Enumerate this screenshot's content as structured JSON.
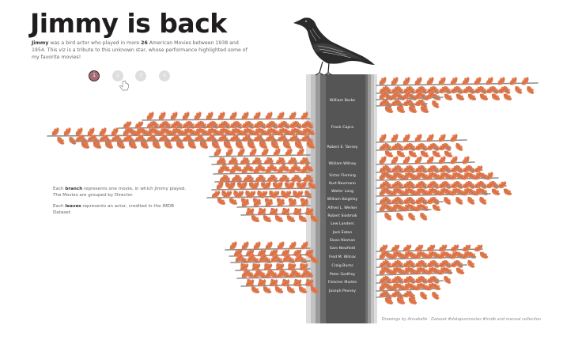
{
  "header": {
    "title": "Jimmy is back",
    "intro_name": "Jimmy",
    "intro_part1": " was a bird actor who played in more ",
    "intro_count": "26",
    "intro_part2": " American Movies between 1938 and 1954. This viz is a tribute to this unknown star, whose performance highlighted some of my favorite movies!"
  },
  "pager": {
    "pages": [
      "1",
      "2",
      "3",
      "4"
    ],
    "active_index": 0
  },
  "legend": {
    "branch_prefix": "Each ",
    "branch_word": "branch",
    "branch_rest": " represents one movie, in which Jimmy played. The Movies are grouped by Director.",
    "leaves_prefix": "Each ",
    "leaves_word": "leaves",
    "leaves_rest": " represents an actor, credited in the IMDB Dataset."
  },
  "directors": [
    {
      "name": "William Berke"
    },
    {
      "name": "Frank Capra"
    },
    {
      "name": "Robert E. Tansey"
    },
    {
      "name": "William Witney"
    },
    {
      "name": "Victor Fleming"
    },
    {
      "name": "Kurt Neumann"
    },
    {
      "name": "Walter Lang"
    },
    {
      "name": "William Keighley"
    },
    {
      "name": "Alfred L. Werker"
    },
    {
      "name": "Robert Siodmak"
    },
    {
      "name": "Lew Landers"
    },
    {
      "name": "Jack Eaton"
    },
    {
      "name": "Sloan Nieman"
    },
    {
      "name": "Sam Newfield"
    },
    {
      "name": "Fred M. Wilcox"
    },
    {
      "name": "Craig Burns"
    },
    {
      "name": "Peter Godfrey"
    },
    {
      "name": "Fletcher Markle"
    },
    {
      "name": "Joseph Pevney"
    }
  ],
  "footer": {
    "credit": "Drawings by Annabelle · Dataset #datapusmovies #imdb and manual collection"
  },
  "colors": {
    "leaf": "#e27b50",
    "leaf_dark": "#b85a35",
    "branch": "#8e8e8e",
    "trunk": "#4a4a4a",
    "bird": "#2b2b2b",
    "accent": "#a56c74"
  },
  "icons": {
    "bird": "crow-illustration",
    "cursor": "hand-pointer-icon"
  }
}
